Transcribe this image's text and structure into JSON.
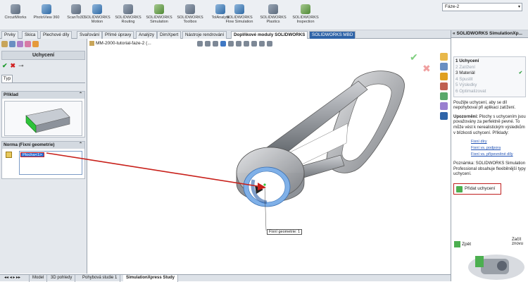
{
  "ribbon": {
    "buttons": [
      {
        "label": "CircuitWorks"
      },
      {
        "label": "PhotoView 360"
      },
      {
        "label": "ScanTo3D"
      },
      {
        "label": "SOLIDWORKS Motion"
      },
      {
        "label": "SOLIDWORKS Routing"
      },
      {
        "label": "SOLIDWORKS Simulation"
      },
      {
        "label": "SOLIDWORKS Toolbox"
      },
      {
        "label": "TolAnalyst"
      },
      {
        "label": "SOLIDWORKS Flow Simulation"
      },
      {
        "label": "SOLIDWORKS Plastics"
      },
      {
        "label": "SOLIDWORKS Inspection"
      }
    ],
    "config_select": "Fáze-2"
  },
  "tabs": [
    "Prvky",
    "Skica",
    "Plechové díly",
    "Svařování",
    "Přímé úpravy",
    "Analýzy",
    "DimXpert",
    "Nástroje rendrování",
    "Doplňkové moduly SOLIDWORKS",
    "SOLIDWORKS MBD"
  ],
  "left_panel": {
    "title": "Uchycení",
    "type_tab": "Typ",
    "example_label": "Příklad",
    "faces_label": "Norma (Fixní geometrie)",
    "face_item": "Plocha<1>"
  },
  "viewport": {
    "tree_label": "MM-2000-tutorial-faze-2 (...",
    "callout": "Fixní geometrie: 1"
  },
  "task_pane": {
    "title": "SOLIDWORKS SimulationXp...",
    "steps": [
      {
        "label": "1 Uchycení",
        "state": "active"
      },
      {
        "label": "2 Zatížení",
        "state": "pending"
      },
      {
        "label": "3 Materiál",
        "state": "done"
      },
      {
        "label": "4 Spustit",
        "state": "pending"
      },
      {
        "label": "5 Výsledky",
        "state": "pending"
      },
      {
        "label": "6 Optimalizovat",
        "state": "pending"
      }
    ],
    "intro": "Použijte uchycení, aby se díl nepohyboval při aplikaci zatížení.",
    "warning_head": "Upozornění:",
    "warning_text": "Plochy s uchycením jsou považovány za perfektně pevné. To může vést k nerealistickým výsledkům v blízkosti uchycení. Příklady:",
    "links": [
      "Fixní díry",
      "Fixní vs. podpora",
      "Fixní vs. přípevněné díly"
    ],
    "note": "Poznámka: SOLIDWORKS Simulation Professional obsahuje flexibilnější typy uchycení.",
    "add_button": "Přidat uchycení",
    "back": "Zpět",
    "next": "Začít znovu"
  },
  "bottom_tabs": [
    "Model",
    "3D pohledy",
    "Pohybová studie 1",
    "SimulationXpress Study"
  ]
}
